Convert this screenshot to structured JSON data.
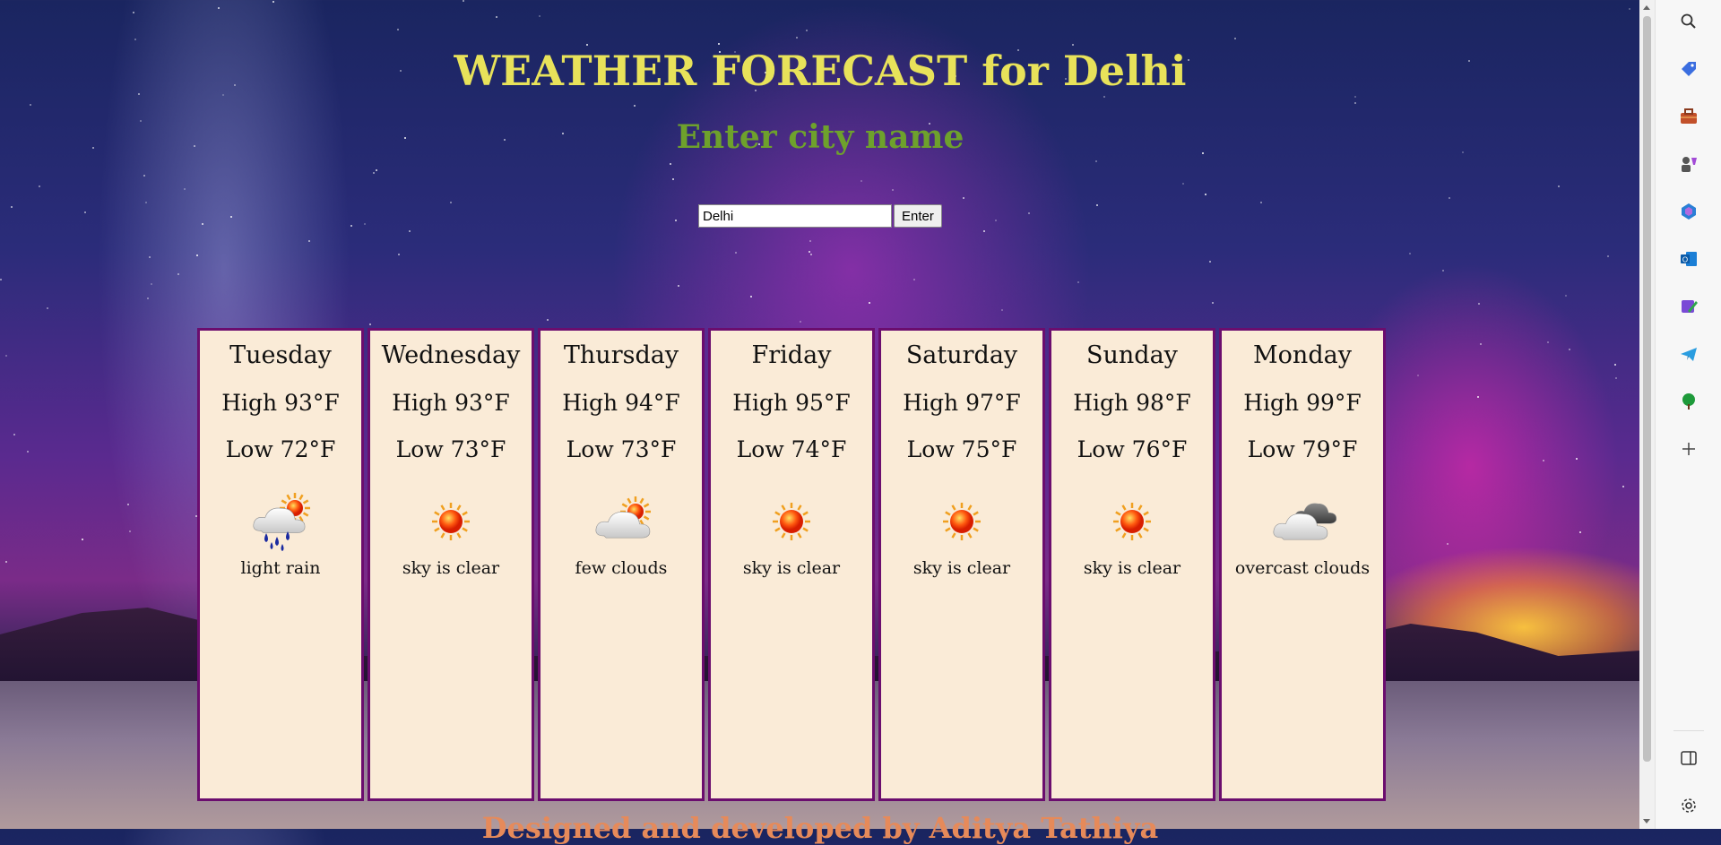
{
  "page": {
    "title": "WEATHER FORECAST for Delhi",
    "subtitle": "Enter city name",
    "footer": "Designed and developed by Aditya Tathiya"
  },
  "search": {
    "value": "Delhi",
    "button_label": "Enter"
  },
  "forecast": [
    {
      "day": "Tuesday",
      "high": "High 93°F",
      "low": "Low 72°F",
      "icon": "rain-sun-icon",
      "desc": "light rain"
    },
    {
      "day": "Wednesday",
      "high": "High 93°F",
      "low": "Low 73°F",
      "icon": "sun-icon",
      "desc": "sky is clear"
    },
    {
      "day": "Thursday",
      "high": "High 94°F",
      "low": "Low 73°F",
      "icon": "cloud-sun-icon",
      "desc": "few clouds"
    },
    {
      "day": "Friday",
      "high": "High 95°F",
      "low": "Low 74°F",
      "icon": "sun-icon",
      "desc": "sky is clear"
    },
    {
      "day": "Saturday",
      "high": "High 97°F",
      "low": "Low 75°F",
      "icon": "sun-icon",
      "desc": "sky is clear"
    },
    {
      "day": "Sunday",
      "high": "High 98°F",
      "low": "Low 76°F",
      "icon": "sun-icon",
      "desc": "sky is clear"
    },
    {
      "day": "Monday",
      "high": "High 99°F",
      "low": "Low 79°F",
      "icon": "overcast-icon",
      "desc": "overcast clouds"
    }
  ],
  "sidebar_icons": [
    "search-icon",
    "tag-icon",
    "briefcase-icon",
    "games-icon",
    "copilot-icon",
    "outlook-icon",
    "designer-icon",
    "telegram-icon",
    "tree-icon",
    "add-icon"
  ],
  "sidebar_bottom_icons": [
    "split-view-icon",
    "settings-icon"
  ],
  "colors": {
    "title": "#e8e25a",
    "subtitle": "#6ea12c",
    "card_bg": "#faebd7",
    "card_border": "#6b0d6e",
    "footer": "#e68a5a"
  }
}
